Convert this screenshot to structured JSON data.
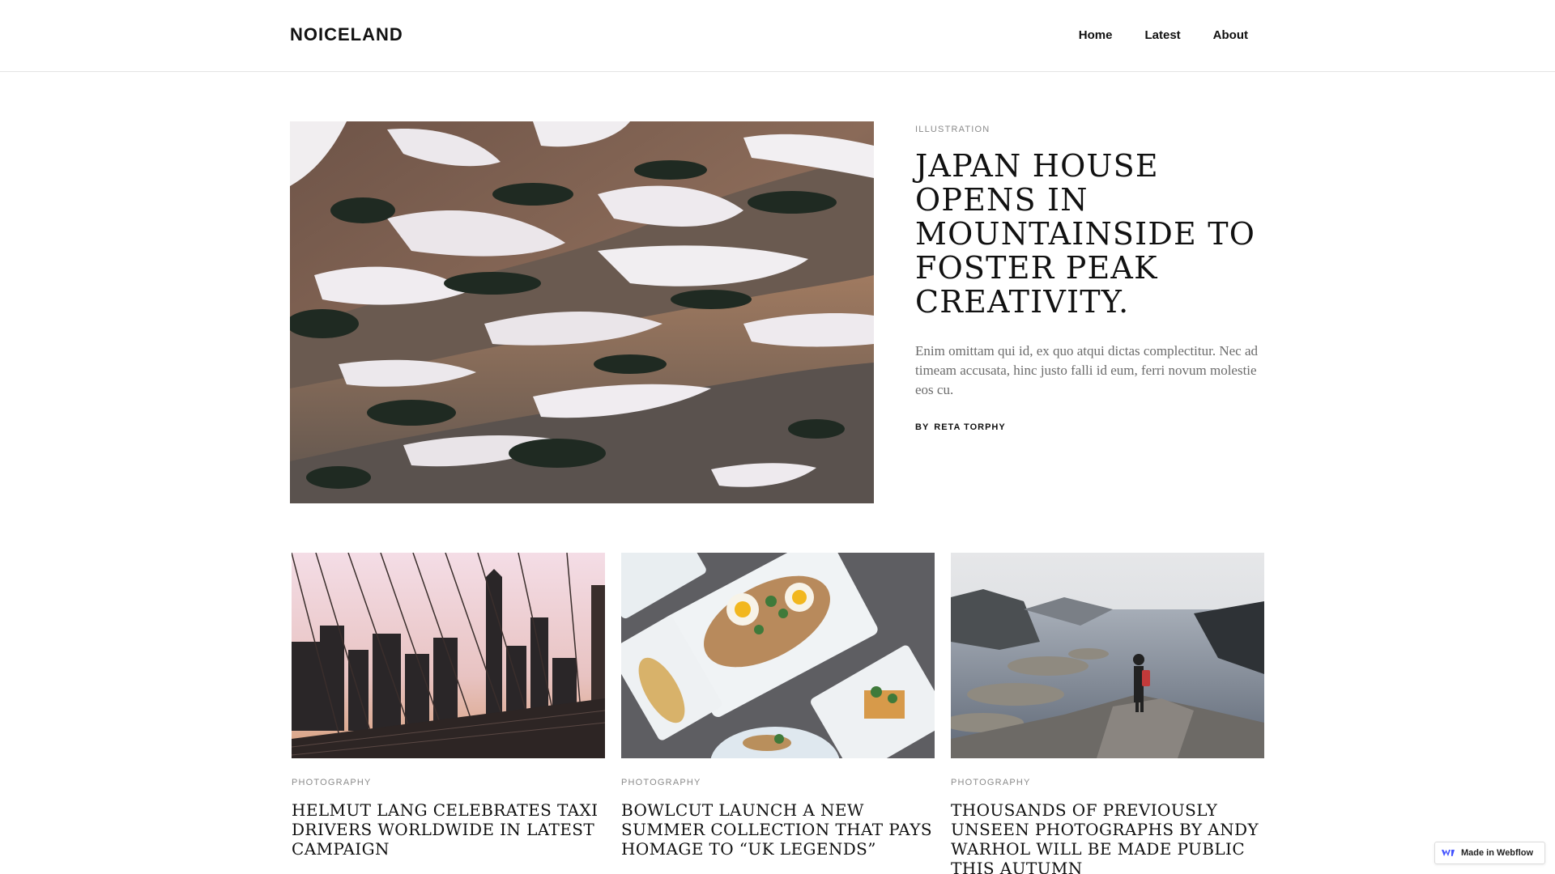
{
  "site": {
    "logo": "NOICELAND",
    "nav": [
      {
        "label": "Home"
      },
      {
        "label": "Latest"
      },
      {
        "label": "About"
      }
    ]
  },
  "featured": {
    "category": "ILLUSTRATION",
    "title": "JAPAN HOUSE OPENS IN MOUNTAINSIDE TO FOSTER PEAK CREATIVITY.",
    "summary": "Enim omittam qui id, ex quo atqui dictas complectitur. Nec ad timeam accusata, hinc justo falli id eum, ferri novum molestie eos cu.",
    "byline_prefix": "BY",
    "author": "RETA TORPHY"
  },
  "cards": [
    {
      "category": "PHOTOGRAPHY",
      "title": "HELMUT LANG CELEBRATES TAXI DRIVERS WORLDWIDE IN LATEST CAMPAIGN"
    },
    {
      "category": "PHOTOGRAPHY",
      "title": "BOWLCUT LAUNCH A NEW SUMMER COLLECTION THAT PAYS HOMAGE TO “UK LEGENDS”"
    },
    {
      "category": "PHOTOGRAPHY",
      "title": "THOUSANDS OF PREVIOUSLY UNSEEN PHOTOGRAPHS BY ANDY WARHOL WILL BE MADE PUBLIC THIS AUTUMN"
    }
  ],
  "badge": {
    "label": "Made in Webflow",
    "icon": "webflow-logo-icon"
  },
  "colors": {
    "text": "#111111",
    "muted": "#8a8a8a",
    "summary": "#6b6b6b",
    "border": "#e4e4e4",
    "webflow_blue": "#4353ff"
  }
}
